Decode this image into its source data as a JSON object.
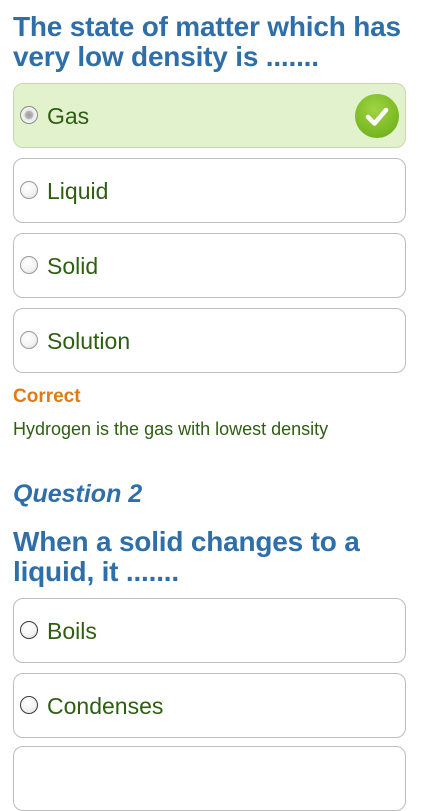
{
  "question1": {
    "title": "The state of matter which has very low density is .......",
    "options": [
      {
        "label": "Gas",
        "state": "selected-correct"
      },
      {
        "label": "Liquid",
        "state": "unselected"
      },
      {
        "label": "Solid",
        "state": "unselected"
      },
      {
        "label": "Solution",
        "state": "unselected"
      }
    ],
    "feedback": {
      "status": "Correct",
      "explanation": "Hydrogen is the gas with lowest density"
    }
  },
  "question2": {
    "number_label": "Question 2",
    "title": "When a solid changes to a liquid, it .......",
    "options": [
      {
        "label": "Boils",
        "state": "unselected"
      },
      {
        "label": "Condenses",
        "state": "unselected"
      }
    ]
  },
  "colors": {
    "title": "#2f6fa9",
    "option_text": "#2e5e12",
    "selected_background": "#e1f2cc",
    "correct_status": "#e07a16",
    "check_badge": "#7dbb26"
  },
  "icons": {
    "radio": "radio-button-icon",
    "check": "checkmark-icon"
  }
}
